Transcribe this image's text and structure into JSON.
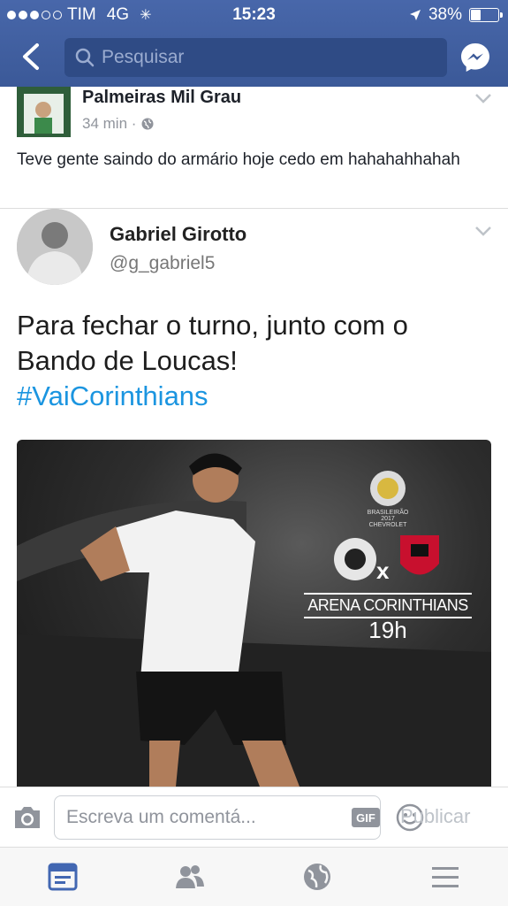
{
  "status": {
    "carrier": "TIM",
    "network": "4G",
    "time": "15:23",
    "battery": "38%",
    "battery_level": 0.38
  },
  "search": {
    "placeholder": "Pesquisar"
  },
  "post": {
    "author": "Palmeiras Mil Grau",
    "time": "34 min ·",
    "text": "Teve gente saindo do armário hoje cedo em hahahahhahah"
  },
  "tweet": {
    "name": "Gabriel Girotto",
    "handle": "@g_gabriel5",
    "text": "Para fechar o turno, junto com o Bando de Loucas!",
    "hashtag": "#VaiCorinthians"
  },
  "media": {
    "badge": "BRASILEIRÃO 2017 CHEVROLET",
    "vs": "x",
    "venue": "ARENA CORINTHIANS",
    "hour": "19h"
  },
  "comment": {
    "placeholder": "Escreva um comentá...",
    "gif": "GIF",
    "publish": "Publicar"
  },
  "icons": [
    "back-icon",
    "search-icon",
    "messenger-icon",
    "globe-icon",
    "chevron-down-icon",
    "camera-icon",
    "smile-icon",
    "news-feed-icon",
    "friends-icon",
    "notifications-globe-icon",
    "menu-icon"
  ],
  "colors": {
    "brand": "#3b5998",
    "hashtag": "#1b95e0",
    "active_tab": "#4267b2",
    "inactive_tab": "#90949c"
  }
}
